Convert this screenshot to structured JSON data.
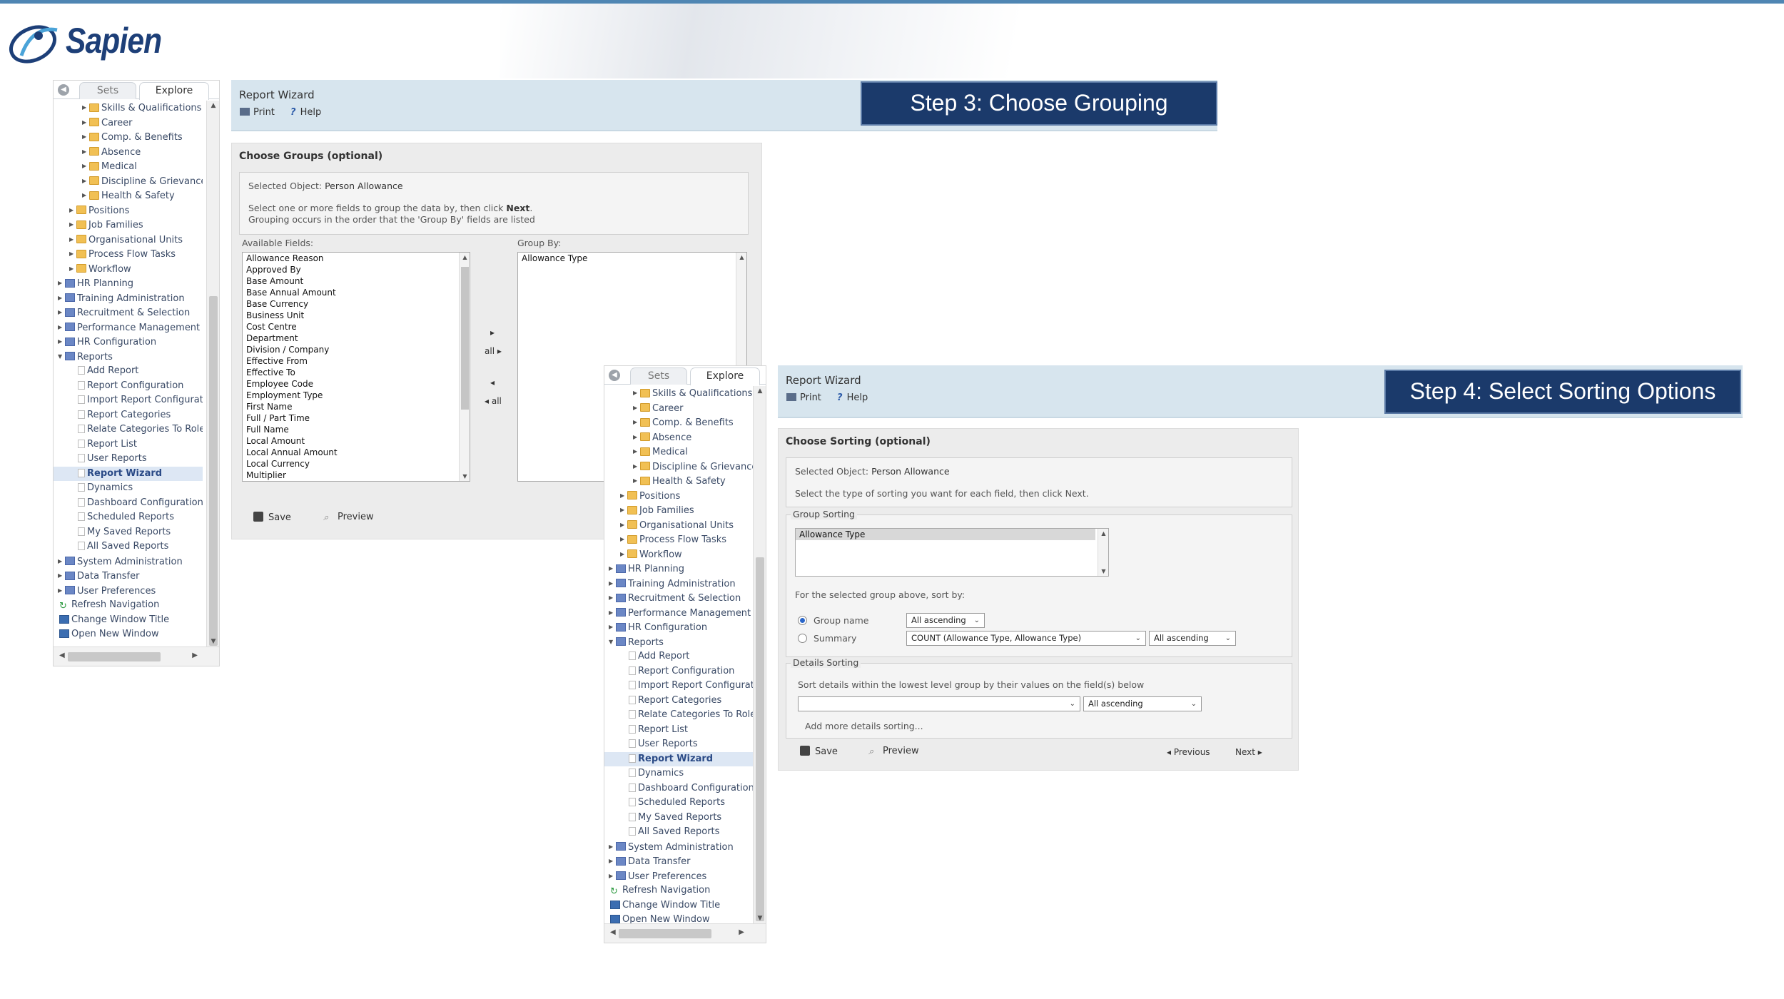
{
  "brand": {
    "name": "Sapien"
  },
  "steps": {
    "step3": "Step 3: Choose Grouping",
    "step4": "Step 4: Select Sorting Options"
  },
  "nav": {
    "tabs": {
      "sets": "Sets",
      "explore": "Explore"
    },
    "items": [
      {
        "label": "Skills & Qualifications",
        "type": "folder",
        "level": 3
      },
      {
        "label": "Career",
        "type": "folder",
        "level": 3
      },
      {
        "label": "Comp. & Benefits",
        "type": "folder",
        "level": 3
      },
      {
        "label": "Absence",
        "type": "folder",
        "level": 3
      },
      {
        "label": "Medical",
        "type": "folder",
        "level": 3
      },
      {
        "label": "Discipline & Grievance",
        "type": "folder",
        "level": 3
      },
      {
        "label": "Health & Safety",
        "type": "folder",
        "level": 3
      },
      {
        "label": "Positions",
        "type": "folder",
        "level": 2
      },
      {
        "label": "Job Families",
        "type": "folder",
        "level": 2
      },
      {
        "label": "Organisational Units",
        "type": "folder",
        "level": 2
      },
      {
        "label": "Process Flow Tasks",
        "type": "folder",
        "level": 2
      },
      {
        "label": "Workflow",
        "type": "folder",
        "level": 2
      },
      {
        "label": "HR Planning",
        "type": "module",
        "level": 1
      },
      {
        "label": "Training Administration",
        "type": "module",
        "level": 1
      },
      {
        "label": "Recruitment & Selection",
        "type": "module",
        "level": 1
      },
      {
        "label": "Performance Management",
        "type": "module",
        "level": 1
      },
      {
        "label": "HR Configuration",
        "type": "module",
        "level": 1
      },
      {
        "label": "Reports",
        "type": "module",
        "level": 1,
        "open": true
      },
      {
        "label": "Add Report",
        "type": "page",
        "level": 2
      },
      {
        "label": "Report Configuration",
        "type": "page",
        "level": 2
      },
      {
        "label": "Import Report Configuratic",
        "type": "page",
        "level": 2
      },
      {
        "label": "Report Categories",
        "type": "page",
        "level": 2
      },
      {
        "label": "Relate Categories To Roles",
        "type": "page",
        "level": 2
      },
      {
        "label": "Report List",
        "type": "page",
        "level": 2
      },
      {
        "label": "User Reports",
        "type": "page",
        "level": 2
      },
      {
        "label": "Report Wizard",
        "type": "page",
        "level": 2,
        "selected": true
      },
      {
        "label": "Dynamics",
        "type": "page",
        "level": 2
      },
      {
        "label": "Dashboard Configuration",
        "type": "page",
        "level": 2
      },
      {
        "label": "Scheduled Reports",
        "type": "page",
        "level": 2
      },
      {
        "label": "My Saved Reports",
        "type": "page",
        "level": 2
      },
      {
        "label": "All Saved Reports",
        "type": "page",
        "level": 2
      },
      {
        "label": "System Administration",
        "type": "module",
        "level": 1
      },
      {
        "label": "Data Transfer",
        "type": "module",
        "level": 1
      },
      {
        "label": "User Preferences",
        "type": "module",
        "level": 1
      },
      {
        "label": "Refresh Navigation",
        "type": "refresh",
        "level": 0
      },
      {
        "label": "Change Window Title",
        "type": "window",
        "level": 0
      },
      {
        "label": "Open New Window",
        "type": "window",
        "level": 0
      }
    ]
  },
  "wizard": {
    "title": "Report Wizard",
    "print": "Print",
    "help": "Help",
    "save": "Save",
    "preview": "Preview"
  },
  "grouping": {
    "heading": "Choose Groups (optional)",
    "selected_object_label": "Selected Object:",
    "selected_object": "Person Allowance",
    "instr_prefix": "Select one or more fields to group the data by, then click ",
    "instr_next": "Next",
    "instr_suffix": ".",
    "instr2": "Grouping occurs in the order that the 'Group By' fields are listed",
    "available_label": "Available Fields:",
    "groupby_label": "Group By:",
    "available_fields": [
      "Allowance Reason",
      "Approved By",
      "Base Amount",
      "Base Annual Amount",
      "Base Currency",
      "Business Unit",
      "Cost Centre",
      "Department",
      "Division / Company",
      "Effective From",
      "Effective To",
      "Employee Code",
      "Employment Type",
      "First Name",
      "Full / Part Time",
      "Full Name",
      "Local Amount",
      "Local Annual Amount",
      "Local Currency",
      "Multiplier"
    ],
    "group_by": [
      "Allowance Type"
    ],
    "move_one": "▸",
    "move_all": "all ▸",
    "back_one": "◂",
    "back_all": "◂ all"
  },
  "sorting": {
    "heading": "Choose Sorting (optional)",
    "selected_object_label": "Selected Object:",
    "selected_object": "Person Allowance",
    "instr": "Select the type of sorting you want for each field, then click Next.",
    "group_sorting_legend": "Group Sorting",
    "group_items": [
      "Allowance Type"
    ],
    "for_selected": "For the selected group above, sort by:",
    "group_name_label": "Group name",
    "group_name_order": "All ascending",
    "summary_label": "Summary",
    "summary_field": "COUNT (Allowance Type, Allowance Type)",
    "summary_order": "All ascending",
    "details_legend": "Details Sorting",
    "details_instr": "Sort details within the lowest level group by their values on the field(s) below",
    "details_field": "",
    "details_order": "All ascending",
    "add_more": "Add more details sorting...",
    "previous": "◂ Previous",
    "next": "Next ▸"
  }
}
